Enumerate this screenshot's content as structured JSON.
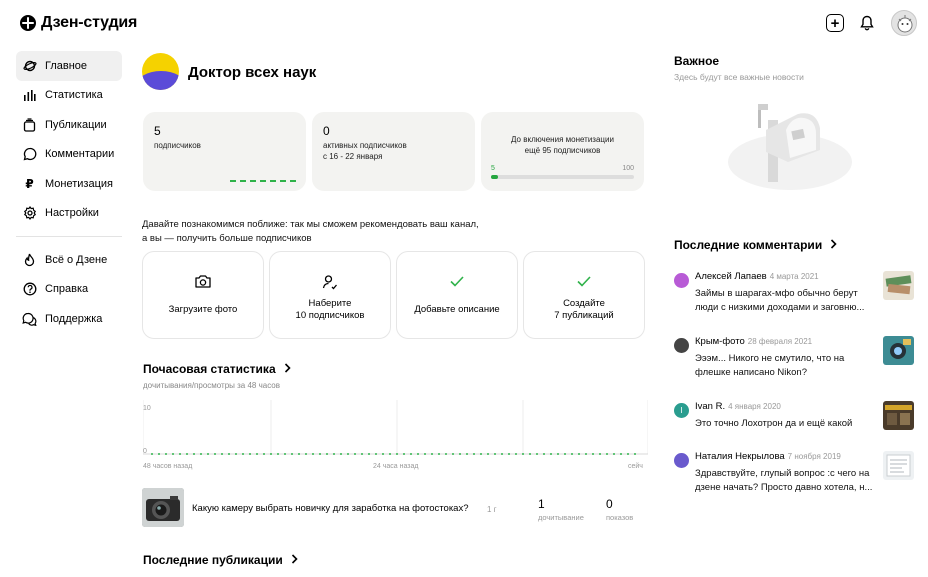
{
  "app": {
    "logo_text": "Дзен-студия"
  },
  "header": {
    "icons": [
      "add-icon",
      "bell-icon",
      "user-avatar"
    ]
  },
  "sidebar": {
    "items": [
      {
        "label": "Главное",
        "icon": "home-planet-icon",
        "active": true
      },
      {
        "label": "Статистика",
        "icon": "stats-icon"
      },
      {
        "label": "Публикации",
        "icon": "publications-icon"
      },
      {
        "label": "Комментарии",
        "icon": "comment-icon"
      },
      {
        "label": "Монетизация",
        "icon": "ruble-icon"
      },
      {
        "label": "Настройки",
        "icon": "gear-icon"
      }
    ],
    "secondary": [
      {
        "label": "Всё о Дзене",
        "icon": "fire-icon"
      },
      {
        "label": "Справка",
        "icon": "help-icon"
      },
      {
        "label": "Поддержка",
        "icon": "support-icon"
      }
    ]
  },
  "channel": {
    "name": "Доктор всех наук"
  },
  "stats": {
    "subscribers": {
      "value": "5",
      "label": "подписчиков"
    },
    "active": {
      "value": "0",
      "label": "активных подписчиков",
      "period": "с 16 - 22 января"
    },
    "monetization": {
      "caption1": "До включения монетизации",
      "caption2": "ещё 95 подписчиков",
      "current": "5",
      "target": "100",
      "progress": 0.05
    }
  },
  "intro": {
    "line1": "Давайте познакомимся поближе: так мы сможем рекомендовать ваш канал,",
    "line2": "а вы — получить больше подписчиков"
  },
  "tasks": [
    {
      "line1": "Загрузите фото",
      "line2": "",
      "icon": "camera-icon",
      "done": false
    },
    {
      "line1": "Наберите",
      "line2": "10 подписчиков",
      "icon": "user-add-icon",
      "done": false
    },
    {
      "line1": "Добавьте описание",
      "line2": "",
      "icon": "check-icon",
      "done": true
    },
    {
      "line1": "Создайте",
      "line2": "7 публикаций",
      "icon": "check-icon",
      "done": true
    }
  ],
  "hourly": {
    "title": "Почасовая статистика",
    "subtitle": "дочитывания/просмотры за 48 часов",
    "chart_data": {
      "type": "line",
      "ylim": [
        0,
        10
      ],
      "y_ticks": [
        "10",
        "0"
      ],
      "x_labels": [
        "48 часов назад",
        "24 часа назад",
        "сейч"
      ],
      "series": [
        {
          "values": [
            0,
            0,
            0,
            0,
            0,
            0,
            0,
            0,
            0,
            0,
            0,
            0,
            0,
            0,
            0,
            0,
            0,
            0,
            0,
            0,
            0,
            0,
            0,
            0,
            0,
            0,
            0,
            0,
            0,
            0,
            0,
            0,
            0,
            0,
            0,
            0,
            0,
            0,
            0,
            0,
            0,
            0,
            0,
            0,
            0,
            0,
            0,
            0
          ]
        }
      ]
    }
  },
  "publication": {
    "title": "Какую камеру выбрать новичку для заработка на фотостоках?",
    "age": "1 г",
    "reads": "1",
    "reads_label": "дочитывание",
    "views": "0",
    "views_label": "показов"
  },
  "latest_pubs": {
    "title": "Последние публикации"
  },
  "important": {
    "title": "Важное",
    "subtitle": "Здесь будут все важные новости"
  },
  "comments": {
    "title": "Последние комментарии",
    "items": [
      {
        "author": "Алексей Лапаев",
        "date": "4 марта 2021",
        "text": "Займы в шарагах-мфо обычно берут люди с низкими доходами и заговню...",
        "avatar_color": "#b85bd6"
      },
      {
        "author": "Крым-фото",
        "date": "28 февраля 2021",
        "text": "Эээм... Никого не смутило, что на флешке написано Nikon?",
        "avatar_color": "#444444"
      },
      {
        "author": "Ivan R.",
        "date": "4 января 2020",
        "text": "Это точно Лохотрон да и ещё какой",
        "avatar_color": "#2a9d8f",
        "initial": "I"
      },
      {
        "author": "Наталия Некрылова",
        "date": "7 ноября 2019",
        "text": "Здравствуйте, глупый вопрос :с чего на дзене начать? Просто давно хотела, н...",
        "avatar_color": "#6a5acd"
      }
    ]
  }
}
